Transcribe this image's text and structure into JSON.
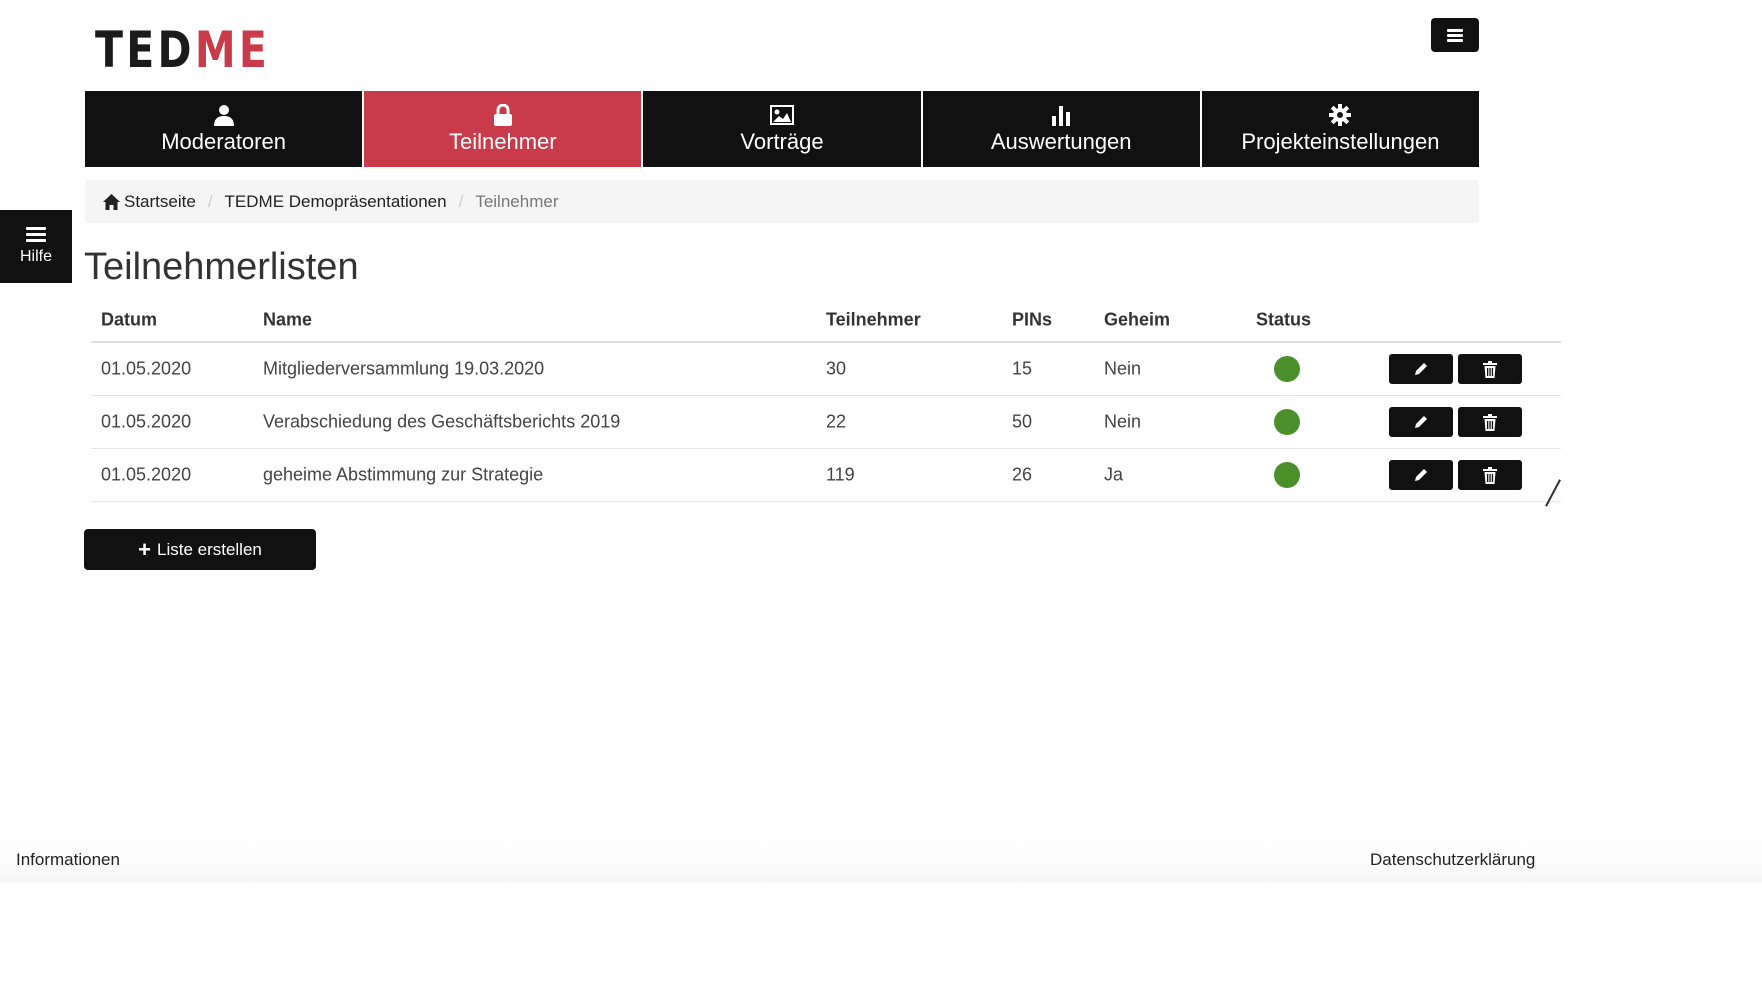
{
  "logo": {
    "part1": "TED",
    "part2": "M",
    "part3": "E"
  },
  "colors": {
    "accent": "#c93a4a",
    "dark": "#111111",
    "status_active": "#4a8f2a"
  },
  "nav": [
    {
      "label": "Moderatoren",
      "icon": "user-icon"
    },
    {
      "label": "Teilnehmer",
      "icon": "lock-icon",
      "active": true
    },
    {
      "label": "Vorträge",
      "icon": "image-icon"
    },
    {
      "label": "Auswertungen",
      "icon": "bar-chart-icon"
    },
    {
      "label": "Projekteinstellungen",
      "icon": "gear-icon"
    }
  ],
  "breadcrumb": {
    "home": "Startseite",
    "project": "TEDME Demopräsentationen",
    "current": "Teilnehmer"
  },
  "help": {
    "label": "Hilfe"
  },
  "page": {
    "title": "Teilnehmerlisten"
  },
  "table": {
    "headers": {
      "datum": "Datum",
      "name": "Name",
      "teilnehmer": "Teilnehmer",
      "pins": "PINs",
      "geheim": "Geheim",
      "status": "Status"
    },
    "rows": [
      {
        "datum": "01.05.2020",
        "name": "Mitgliederversammlung 19.03.2020",
        "teilnehmer": "30",
        "pins": "15",
        "geheim": "Nein",
        "status": "active"
      },
      {
        "datum": "01.05.2020",
        "name": "Verabschiedung des Geschäftsberichts 2019",
        "teilnehmer": "22",
        "pins": "50",
        "geheim": "Nein",
        "status": "active"
      },
      {
        "datum": "01.05.2020",
        "name": "geheime Abstimmung zur Strategie",
        "teilnehmer": "119",
        "pins": "26",
        "geheim": "Ja",
        "status": "active"
      }
    ]
  },
  "create_button": {
    "label": "Liste erstellen"
  },
  "footer": {
    "left": "Informationen",
    "right": "Datenschutzerklärung"
  }
}
